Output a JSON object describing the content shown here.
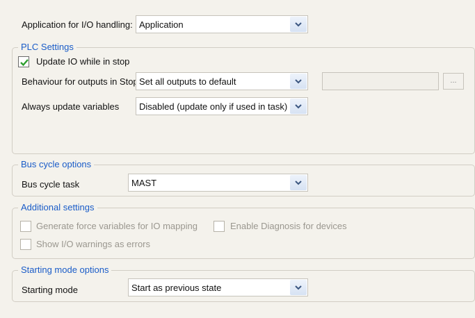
{
  "io_handling": {
    "label": "Application for I/O handling:",
    "value": "Application"
  },
  "plc_settings": {
    "legend": "PLC Settings",
    "update_io_label": "Update IO while in stop",
    "update_io_checked": true,
    "behaviour_label": "Behaviour for outputs in Stop",
    "behaviour_value": "Set all outputs to default",
    "browse_button": "...",
    "always_update_label": "Always update variables",
    "always_update_value": "Disabled (update only if used in task)"
  },
  "bus_cycle": {
    "legend": "Bus cycle options",
    "task_label": "Bus cycle task",
    "task_value": "MAST"
  },
  "additional": {
    "legend": "Additional settings",
    "force_vars_label": "Generate force variables for IO mapping",
    "diagnosis_label": "Enable Diagnosis for devices",
    "warnings_label": "Show I/O warnings as errors"
  },
  "starting_mode": {
    "legend": "Starting mode options",
    "mode_label": "Starting mode",
    "mode_value": "Start as previous state"
  },
  "colors": {
    "accent": "#1a5cc8",
    "check": "#2e9e2e",
    "background": "#f4f2ec"
  }
}
